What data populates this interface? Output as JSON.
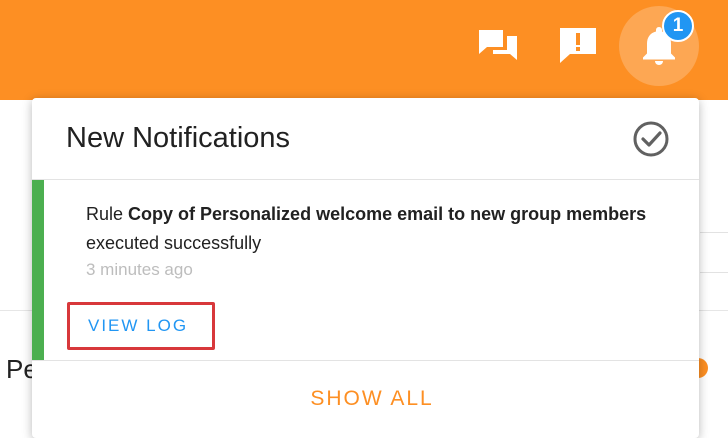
{
  "topbar": {
    "color": "#fd8f23",
    "icons": [
      "chat-icon",
      "feedback-icon",
      "bell-icon"
    ],
    "notification_count": "1"
  },
  "background": {
    "left_text": "Pe"
  },
  "notifications_panel": {
    "title": "New Notifications",
    "mark_read_icon": "check-circle-icon",
    "items": [
      {
        "prefix": "Rule ",
        "rule_name": "Copy of Personalized welcome email to new group members",
        "suffix": " executed successfully",
        "time": "3 minutes ago",
        "action_label": "VIEW LOG",
        "status_color": "#4caf50"
      }
    ],
    "footer_label": "SHOW ALL"
  }
}
